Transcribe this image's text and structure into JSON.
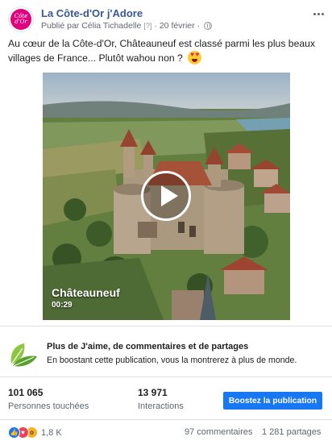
{
  "post": {
    "page_name": "La Côte-d'Or j'Adore",
    "avatar_text_line1": "Côte",
    "avatar_text_line2": "d'Or",
    "published_by": "Publié par Célia Tichadelle",
    "help_marker": "[?]",
    "separator": "·",
    "date": "20 février",
    "text": "Au cœur de la Côte-d'Or, Châteauneuf est classé parmi les plus beaux villages de France... Plutôt wahou non ?",
    "emoji_icon": "heart-eyes-emoji",
    "privacy_icon": "globe-icon"
  },
  "video": {
    "title": "Châteauneuf",
    "duration": "00:29",
    "play_icon": "play-icon"
  },
  "boost_banner": {
    "icon": "leaf-icon",
    "title": "Plus de J'aime, de commentaires et de partages",
    "description": "En boostant cette publication, vous la montrerez à plus de monde."
  },
  "stats": {
    "reach_value": "101 065",
    "reach_label": "Personnes touchées",
    "interactions_value": "13 971",
    "interactions_label": "Interactions",
    "boost_button_label": "Boostez la publication"
  },
  "footer": {
    "reaction_count": "1,8 K",
    "comments": "97 commentaires",
    "shares": "1 281 partages"
  },
  "colors": {
    "link_blue": "#385898",
    "button_blue": "#1877f2",
    "brand_pink": "#e3007e"
  }
}
